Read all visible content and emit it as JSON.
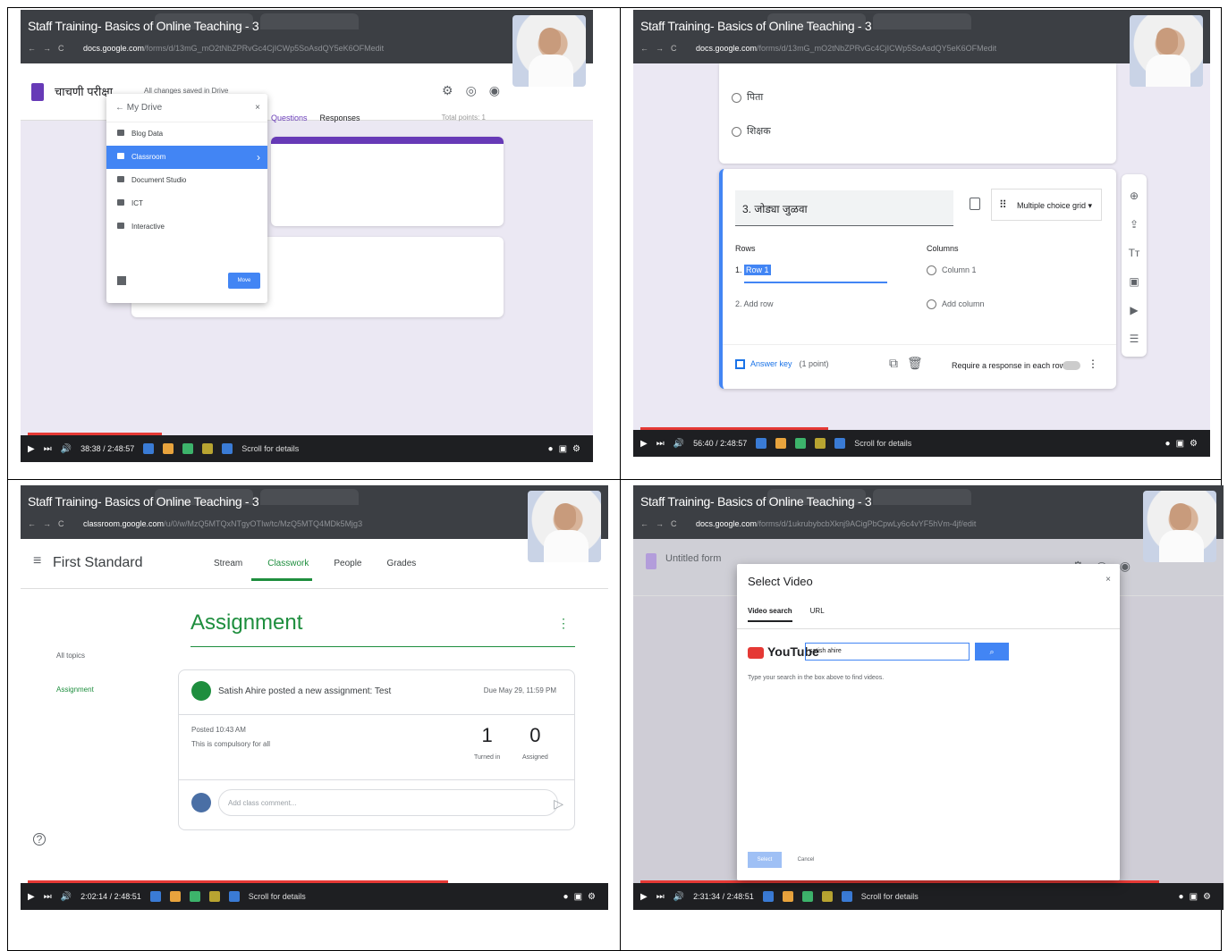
{
  "video": {
    "title": "Staff Training- Basics of Online Teaching - 3",
    "scroll_hint": "Scroll for details"
  },
  "frames": [
    {
      "address": {
        "host": "docs.google.com",
        "path": "/forms/d/13mG_mO2tNbZPRvGc4CjICWp5SoAsdQY5eK6OFMedit"
      },
      "time": "38:38 / 2:48:57",
      "form_title": "चाचणी परीक्षा",
      "saved": "All changes saved in Drive",
      "tabs": [
        "Questions",
        "Responses"
      ],
      "total_points": "Total points: 1",
      "drive": {
        "header": "My Drive",
        "items": [
          "Blog Data",
          "Classroom",
          "Document Studio",
          "ICT",
          "Interactive"
        ],
        "selected": "Classroom",
        "move_label": "Move"
      }
    },
    {
      "address": {
        "host": "docs.google.com",
        "path": "/forms/d/13mG_mO2tNbZPRvGc4CjICWp5SoAsdQY5eK6OFMedit"
      },
      "time": "56:40 / 2:48:57",
      "options": [
        "पिता",
        "शिक्षक"
      ],
      "question": {
        "number": "3.",
        "title": "जोड्या जुळवा",
        "type": "Multiple choice grid"
      },
      "rows_label": "Rows",
      "columns_label": "Columns",
      "row1": "Row 1",
      "row2": "Add row",
      "col1": "Column 1",
      "col2": "Add column",
      "answer_key": "Answer key",
      "points": "(1 point)",
      "require": "Require a response in each row"
    },
    {
      "address": {
        "host": "classroom.google.com",
        "path": "/u/0/w/MzQ5MTQxNTgyOTIw/tc/MzQ5MTQ4MDk5Mjg3"
      },
      "time": "2:02:14 / 2:48:51",
      "class_title": "First Standard",
      "tabs": [
        "Stream",
        "Classwork",
        "People",
        "Grades"
      ],
      "topics": [
        "All topics",
        "Assignment"
      ],
      "section": "Assignment",
      "post_text": "Satish Ahire posted a new assignment: Test",
      "due": "Due May 29, 11:59 PM",
      "posted": "Posted 10:43 AM",
      "description": "This is compulsory for all",
      "turned_in": {
        "value": "1",
        "label": "Turned in"
      },
      "assigned": {
        "value": "0",
        "label": "Assigned"
      },
      "comment_placeholder": "Add class comment..."
    },
    {
      "address": {
        "host": "docs.google.com",
        "path": "/forms/d/1ukrubybcbXknj9ACigPbCpwLy6c4vYF5hVm-4jf/edit"
      },
      "time": "2:31:34 / 2:48:51",
      "form_title": "Untitled form",
      "dialog": {
        "title": "Select Video",
        "tabs": [
          "Video search",
          "URL"
        ],
        "brand": "YouTube",
        "search_value": "satish ahire",
        "hint": "Type your search in the box above to find videos.",
        "select": "Select",
        "cancel": "Cancel"
      }
    }
  ]
}
